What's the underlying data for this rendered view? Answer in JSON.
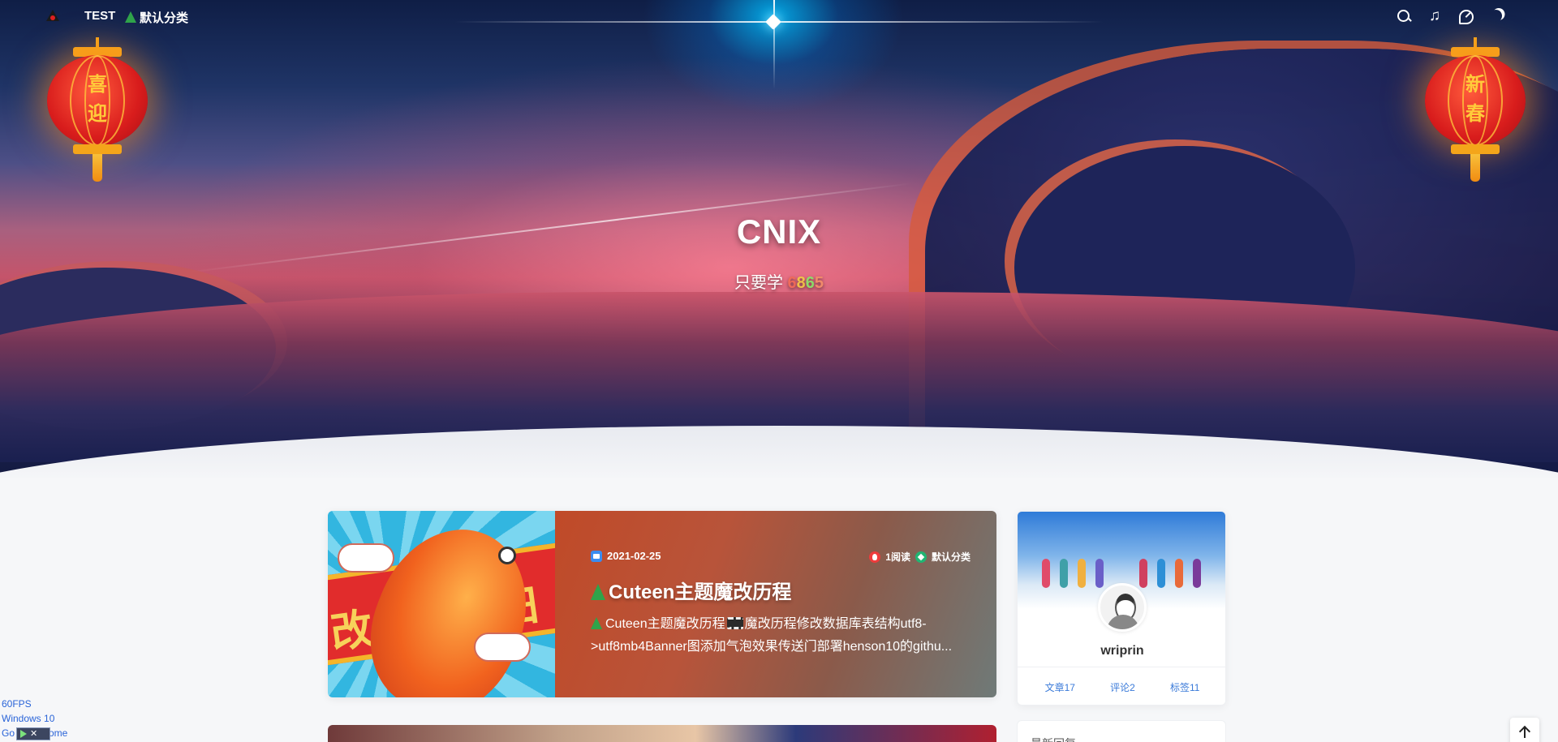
{
  "nav": {
    "brand": "TEST",
    "category": "默认分类",
    "icons": [
      "search-icon",
      "music-icon",
      "palette-icon",
      "moon-icon"
    ]
  },
  "hero": {
    "title": "CNIX",
    "subtitle_prefix": "只要学",
    "subtitle_highlight": [
      "6",
      "8",
      "6",
      "5"
    ],
    "lantern_left": [
      "喜",
      "迎"
    ],
    "lantern_right": [
      "新",
      "春"
    ]
  },
  "post": {
    "date": "2021-02-25",
    "reads": "1阅读",
    "category": "默认分类",
    "title": "Cuteen主题魔改历程",
    "excerpt_a": "Cuteen主题魔改历程",
    "excerpt_b": "魔改历程修改数据库表结构utf8->utf8mb4Banner图添加气泡效果传送门部署henson10的githu...",
    "thumb_text_left": "改",
    "thumb_text_right": "日"
  },
  "sidebar": {
    "name": "wriprin",
    "stats": {
      "posts": "文章17",
      "comments": "评论2",
      "tags": "标签11"
    },
    "next_title": "最新回复"
  },
  "debug": {
    "fps": "60FPS",
    "os": "Windows 10",
    "browser_prefix": "Go",
    "browser_suffix": "rome"
  },
  "colors": {
    "accent": "#3a7ad9",
    "lantern": "#d81c1c",
    "lantern_gold": "#f4a51a"
  }
}
